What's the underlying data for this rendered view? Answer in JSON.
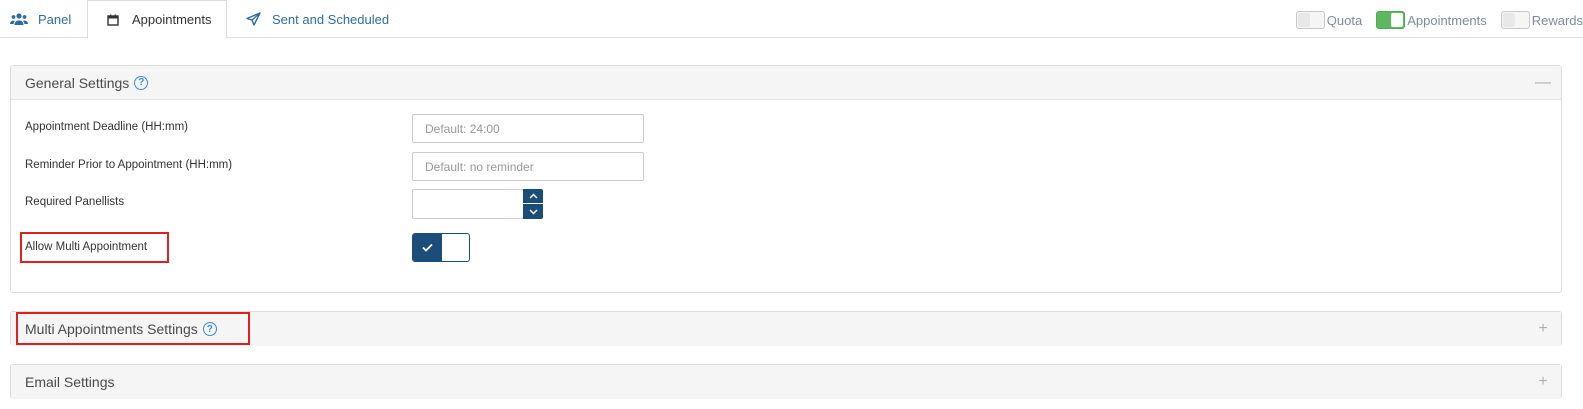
{
  "tabs": {
    "panel": "Panel",
    "appointments": "Appointments",
    "sent": "Sent and Scheduled"
  },
  "toggles": [
    {
      "label": "Quota",
      "state": "off"
    },
    {
      "label": "Appointments",
      "state": "on"
    },
    {
      "label": "Rewards",
      "state": "off"
    }
  ],
  "general": {
    "title": "General Settings",
    "help": "?",
    "collapse": "—",
    "deadline_label": "Appointment Deadline (HH:mm)",
    "deadline_placeholder": "Default: 24:00",
    "reminder_label": "Reminder Prior to Appointment (HH:mm)",
    "reminder_placeholder": "Default: no reminder",
    "panellists_label": "Required Panellists",
    "multi_label": "Allow Multi Appointment"
  },
  "multi": {
    "title": "Multi Appointments Settings",
    "help": "?",
    "expand": "+"
  },
  "email": {
    "title": "Email Settings",
    "expand": "+"
  },
  "colors": {
    "link": "#2e6da4",
    "toggle_on": "#5cb85c",
    "primary_dark": "#1b4d7a",
    "highlight": "#e02020"
  }
}
